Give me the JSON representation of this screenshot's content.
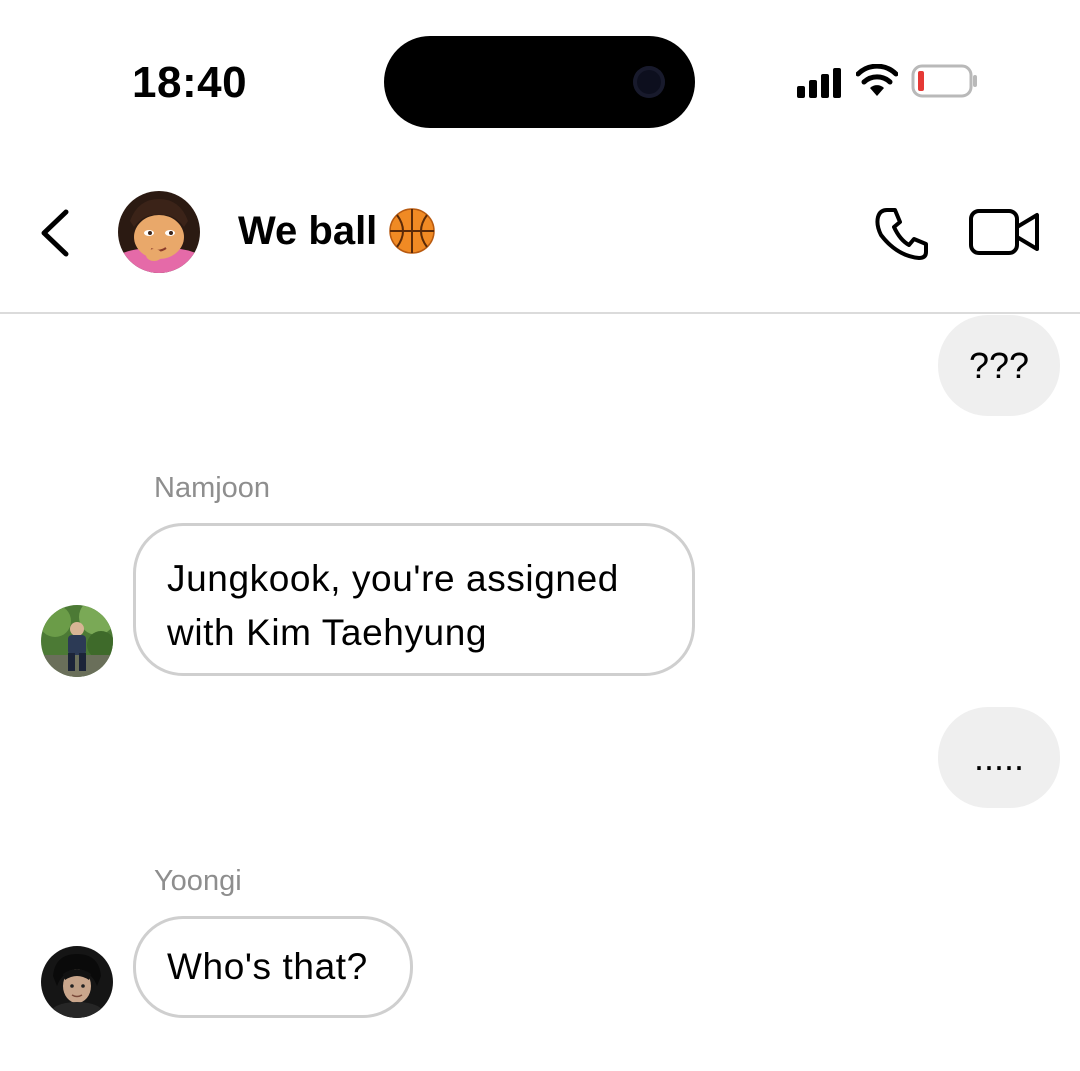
{
  "status_bar": {
    "time": "18:40",
    "icons": [
      "cellular-signal-icon",
      "wifi-icon",
      "battery-low-icon"
    ],
    "battery_color": "#e53935"
  },
  "header": {
    "group_name": "We ball",
    "group_emoji_icon": "basketball-icon",
    "icons": [
      "back-chevron-icon",
      "phone-call-icon",
      "video-call-icon"
    ]
  },
  "messages": [
    {
      "direction": "outgoing",
      "text": "???"
    },
    {
      "direction": "incoming",
      "sender": "Namjoon",
      "text_lines": [
        "Jungkook, you're assigned",
        "with Kim Taehyung"
      ]
    },
    {
      "direction": "outgoing",
      "text": "....."
    },
    {
      "direction": "incoming",
      "sender": "Yoongi",
      "text": "Who's that?"
    }
  ],
  "colors": {
    "outgoing_bubble": "#efefef",
    "incoming_border": "#cfcfcf",
    "sender_name": "#8e8e8e",
    "divider": "#dbdbdb"
  }
}
